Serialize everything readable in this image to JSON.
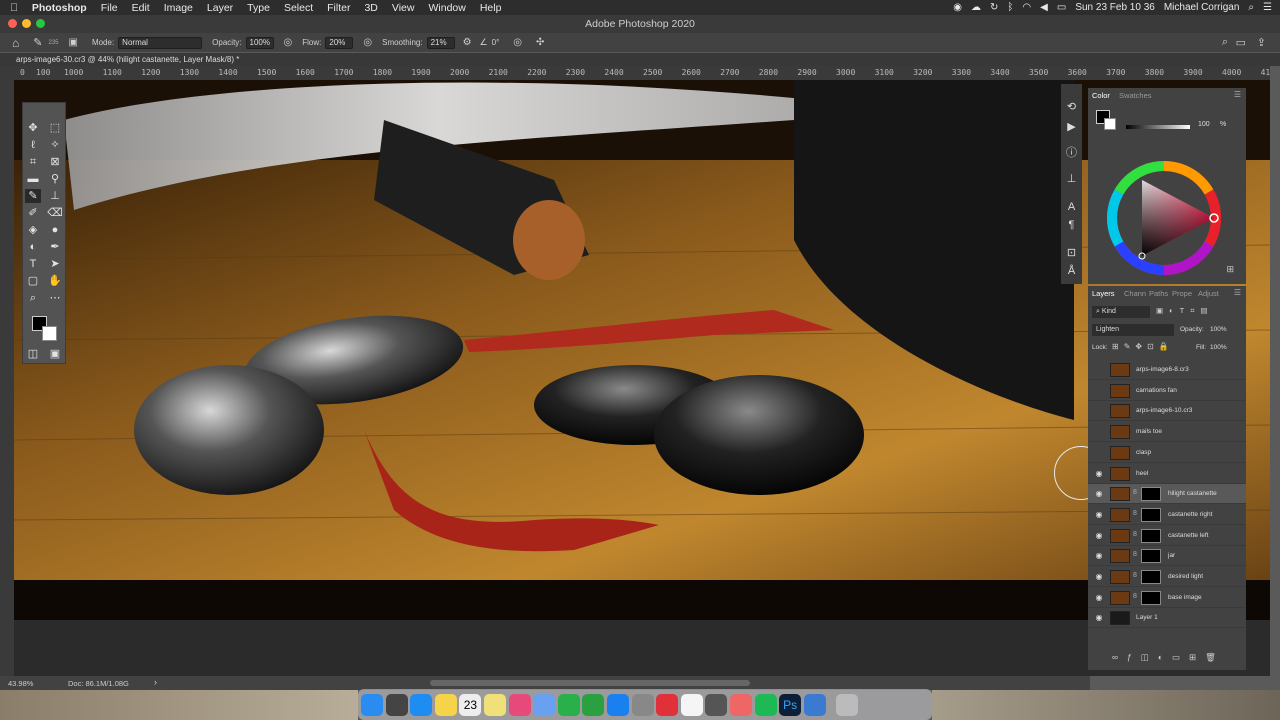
{
  "menubar": {
    "app": "Photoshop",
    "items": [
      "File",
      "Edit",
      "Image",
      "Layer",
      "Type",
      "Select",
      "Filter",
      "3D",
      "View",
      "Window",
      "Help"
    ],
    "datetime": "Sun 23 Feb 10 36",
    "user": "Michael Corrigan"
  },
  "window": {
    "title": "Adobe Photoshop 2020"
  },
  "options": {
    "brush_size": "235",
    "mode_label": "Mode:",
    "mode_value": "Normal",
    "opacity_label": "Opacity:",
    "opacity_value": "100%",
    "flow_label": "Flow:",
    "flow_value": "20%",
    "smoothing_label": "Smoothing:",
    "smoothing_value": "21%",
    "angle_value": "0°"
  },
  "document": {
    "tab_title": "arps-image6-30.cr3 @ 44% (hilight castanette, Layer Mask/8) *"
  },
  "ruler": {
    "ticks": [
      "0",
      "100",
      "1000",
      "1100",
      "1200",
      "1300",
      "1400",
      "1500",
      "1600",
      "1700",
      "1800",
      "1900",
      "2000",
      "2100",
      "2200",
      "2300",
      "2400",
      "2500",
      "2600",
      "2700",
      "2800",
      "2900",
      "3000",
      "3100",
      "3200",
      "3300",
      "3400",
      "3500",
      "3600",
      "3700",
      "3800",
      "3900",
      "4000",
      "4100",
      "4200"
    ]
  },
  "status": {
    "zoom": "43.98%",
    "doc": "Doc: 86.1M/1.08G"
  },
  "color_panel": {
    "tabs": [
      "Color",
      "Swatches"
    ],
    "slider_value": "100",
    "slider_unit": "%",
    "fg_color": "#000000",
    "bg_color": "#ffffff"
  },
  "layers_panel": {
    "tabs": [
      "Layers",
      "Chann",
      "Paths",
      "Prope",
      "Adjust"
    ],
    "filter_label": "Kind",
    "blend_mode": "Lighten",
    "opacity_label": "Opacity:",
    "opacity_value": "100%",
    "lock_label": "Lock:",
    "fill_label": "Fill:",
    "fill_value": "100%",
    "layers": [
      {
        "name": "arps-image6-8.cr3",
        "visible": false,
        "mask": false
      },
      {
        "name": "carnations fan",
        "visible": false,
        "mask": false
      },
      {
        "name": "arps-image6-10.cr3",
        "visible": false,
        "mask": false
      },
      {
        "name": "mails toe",
        "visible": false,
        "mask": false
      },
      {
        "name": "clasp",
        "visible": false,
        "mask": false
      },
      {
        "name": "heel",
        "visible": true,
        "mask": false
      },
      {
        "name": "hilight castanette",
        "visible": true,
        "mask": true,
        "selected": true
      },
      {
        "name": "castanette right",
        "visible": true,
        "mask": true
      },
      {
        "name": "castanette left",
        "visible": true,
        "mask": true
      },
      {
        "name": "jar",
        "visible": true,
        "mask": true
      },
      {
        "name": "desired light",
        "visible": true,
        "mask": true
      },
      {
        "name": "base image",
        "visible": true,
        "mask": true
      },
      {
        "name": "Layer 1",
        "visible": true,
        "mask": false
      }
    ]
  },
  "dock": {
    "apps": [
      "finder-icon",
      "launchpad-icon",
      "safari-icon",
      "notes-icon",
      "calendar-icon",
      "stickies-icon",
      "itunes-icon",
      "preview-icon",
      "messages-icon",
      "facetime-icon",
      "app-store-icon",
      "system-prefs-icon",
      "news-icon",
      "chrome-icon",
      "power-icon",
      "capture-icon",
      "spotify-icon",
      "photoshop-icon",
      "other-icon",
      "trash-icon"
    ],
    "calendar_day": "23",
    "photoshop_label": "Ps"
  }
}
